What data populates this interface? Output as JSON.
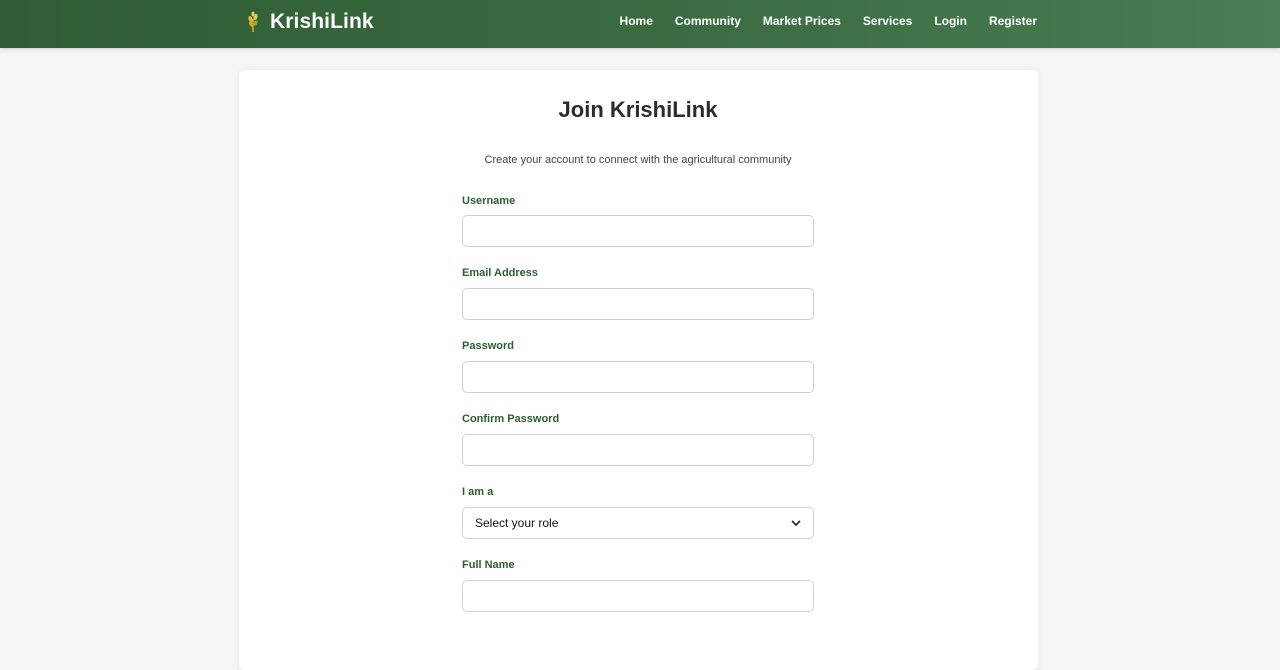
{
  "brand": {
    "name": "KrishiLink",
    "icon": "wheat-icon"
  },
  "nav": {
    "items": [
      {
        "label": "Home"
      },
      {
        "label": "Community"
      },
      {
        "label": "Market Prices"
      },
      {
        "label": "Services"
      },
      {
        "label": "Login"
      },
      {
        "label": "Register"
      }
    ]
  },
  "form": {
    "title": "Join KrishiLink",
    "subtitle": "Create your account to connect with the agricultural community",
    "fields": {
      "username": {
        "label": "Username",
        "value": ""
      },
      "email": {
        "label": "Email Address",
        "value": ""
      },
      "password": {
        "label": "Password",
        "value": ""
      },
      "confirm_password": {
        "label": "Confirm Password",
        "value": ""
      },
      "role": {
        "label": "I am a",
        "selected": "Select your role"
      },
      "full_name": {
        "label": "Full Name",
        "value": ""
      }
    }
  },
  "colors": {
    "nav_start": "#2f5c34",
    "nav_end": "#4a7d52",
    "label_green": "#2f5c34"
  }
}
